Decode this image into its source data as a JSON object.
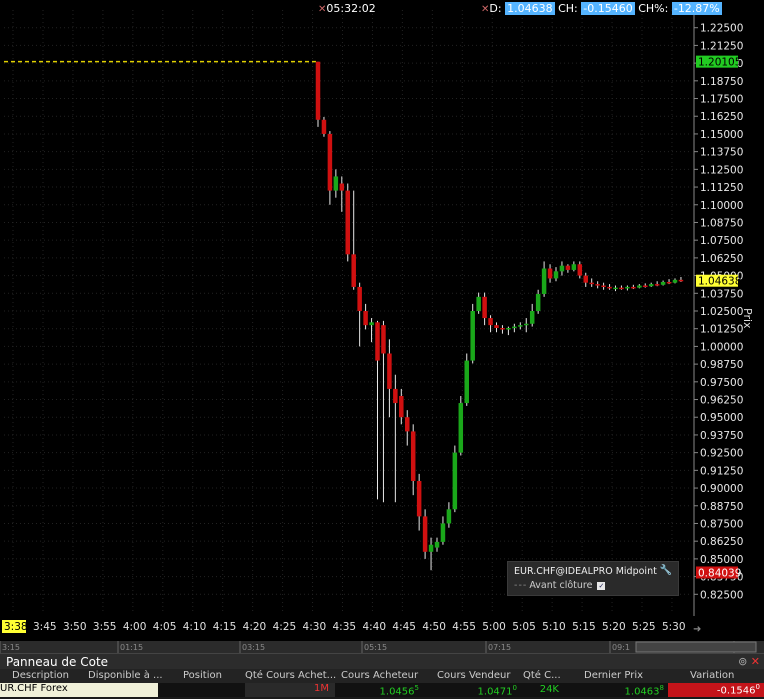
{
  "header": {
    "time": "05:32:02",
    "d_label": "D:",
    "d_value": "1.04638",
    "ch_label": "CH:",
    "ch_value": "-0.15460",
    "chpct_label": "CH%:",
    "chpct_value": "-12.87%"
  },
  "colors": {
    "up": "#1aa81a",
    "down": "#d01010",
    "prior_close": "#e0d000",
    "pill": "#55b4ff",
    "current_price_bg": "#ffff33",
    "prior_close_bg": "#22cc22",
    "low_bg": "#d01010"
  },
  "y_axis": {
    "title": "Prix",
    "min": 0.8125,
    "max": 1.2375,
    "ticks": [
      "1.22500",
      "1.21250",
      "1.20000",
      "1.18750",
      "1.17500",
      "1.16250",
      "1.15000",
      "1.13750",
      "1.12500",
      "1.11250",
      "1.10000",
      "1.08750",
      "1.07500",
      "1.06250",
      "1.05000",
      "1.03750",
      "1.02500",
      "1.01250",
      "1.00000",
      "0.98750",
      "0.97500",
      "0.96250",
      "0.95000",
      "0.93750",
      "0.92500",
      "0.91250",
      "0.90000",
      "0.88750",
      "0.87500",
      "0.86250",
      "0.85000",
      "0.83750",
      "0.82500"
    ],
    "markers": [
      {
        "label": "1.20105",
        "value": 1.20105,
        "kind": "prior_close"
      },
      {
        "label": "1.04638",
        "value": 1.04638,
        "kind": "current"
      },
      {
        "label": "0.84039",
        "value": 0.84039,
        "kind": "low"
      }
    ]
  },
  "x_axis": {
    "labels": [
      "3:38",
      "3:45",
      "3:50",
      "3:55",
      "4:00",
      "4:05",
      "4:10",
      "4:15",
      "4:20",
      "4:25",
      "4:30",
      "4:35",
      "4:40",
      "4:45",
      "4:50",
      "4:55",
      "5:00",
      "5:05",
      "5:10",
      "5:15",
      "5:20",
      "5:25",
      "5:30"
    ],
    "highlighted": "3:38"
  },
  "chart_data": {
    "type": "candlestick",
    "instrument": "EUR.CHF@IDEALPRO Midpoint",
    "prior_close": 1.20105,
    "prior_close_label": "Avant clôture",
    "candles": [
      {
        "t": "4:30",
        "o": 1.201,
        "h": 1.201,
        "l": 1.155,
        "c": 1.16
      },
      {
        "t": "4:31",
        "o": 1.16,
        "h": 1.162,
        "l": 1.148,
        "c": 1.15
      },
      {
        "t": "4:32",
        "o": 1.15,
        "h": 1.152,
        "l": 1.1,
        "c": 1.11
      },
      {
        "t": "4:33",
        "o": 1.11,
        "h": 1.125,
        "l": 1.105,
        "c": 1.12
      },
      {
        "t": "4:34",
        "o": 1.115,
        "h": 1.12,
        "l": 1.095,
        "c": 1.11
      },
      {
        "t": "4:35",
        "o": 1.11,
        "h": 1.115,
        "l": 1.06,
        "c": 1.065
      },
      {
        "t": "4:36",
        "o": 1.065,
        "h": 1.11,
        "l": 1.04,
        "c": 1.042
      },
      {
        "t": "4:37",
        "o": 1.042,
        "h": 1.045,
        "l": 1.0,
        "c": 1.025
      },
      {
        "t": "4:38",
        "o": 1.025,
        "h": 1.03,
        "l": 1.012,
        "c": 1.015
      },
      {
        "t": "4:39",
        "o": 1.015,
        "h": 1.02,
        "l": 1.003,
        "c": 1.017
      },
      {
        "t": "4:40",
        "o": 1.017,
        "h": 1.018,
        "l": 0.892,
        "c": 0.99
      },
      {
        "t": "4:41",
        "o": 1.015,
        "h": 1.018,
        "l": 0.89,
        "c": 0.995
      },
      {
        "t": "4:42",
        "o": 0.995,
        "h": 1.005,
        "l": 0.95,
        "c": 0.97
      },
      {
        "t": "4:43",
        "o": 0.97,
        "h": 0.98,
        "l": 0.89,
        "c": 0.96
      },
      {
        "t": "4:44",
        "o": 0.965,
        "h": 0.97,
        "l": 0.945,
        "c": 0.95
      },
      {
        "t": "4:45",
        "o": 0.95,
        "h": 0.955,
        "l": 0.93,
        "c": 0.94
      },
      {
        "t": "4:46",
        "o": 0.94,
        "h": 0.945,
        "l": 0.895,
        "c": 0.905
      },
      {
        "t": "4:47",
        "o": 0.905,
        "h": 0.91,
        "l": 0.87,
        "c": 0.88
      },
      {
        "t": "4:48",
        "o": 0.88,
        "h": 0.885,
        "l": 0.85,
        "c": 0.855
      },
      {
        "t": "4:49",
        "o": 0.855,
        "h": 0.865,
        "l": 0.842,
        "c": 0.86
      },
      {
        "t": "4:50",
        "o": 0.858,
        "h": 0.865,
        "l": 0.855,
        "c": 0.862
      },
      {
        "t": "4:51",
        "o": 0.862,
        "h": 0.88,
        "l": 0.86,
        "c": 0.875
      },
      {
        "t": "4:52",
        "o": 0.875,
        "h": 0.89,
        "l": 0.872,
        "c": 0.885
      },
      {
        "t": "4:53",
        "o": 0.885,
        "h": 0.93,
        "l": 0.883,
        "c": 0.925
      },
      {
        "t": "4:54",
        "o": 0.925,
        "h": 0.965,
        "l": 0.923,
        "c": 0.96
      },
      {
        "t": "4:55",
        "o": 0.96,
        "h": 0.995,
        "l": 0.958,
        "c": 0.99
      },
      {
        "t": "4:56",
        "o": 0.99,
        "h": 1.03,
        "l": 0.988,
        "c": 1.025
      },
      {
        "t": "4:57",
        "o": 1.025,
        "h": 1.038,
        "l": 1.023,
        "c": 1.035
      },
      {
        "t": "4:58",
        "o": 1.035,
        "h": 1.038,
        "l": 1.015,
        "c": 1.02
      },
      {
        "t": "4:59",
        "o": 1.02,
        "h": 1.022,
        "l": 1.01,
        "c": 1.015
      },
      {
        "t": "5:00",
        "o": 1.015,
        "h": 1.017,
        "l": 1.01,
        "c": 1.013
      },
      {
        "t": "5:01",
        "o": 1.013,
        "h": 1.015,
        "l": 1.009,
        "c": 1.012
      },
      {
        "t": "5:02",
        "o": 1.012,
        "h": 1.014,
        "l": 1.008,
        "c": 1.013
      },
      {
        "t": "5:03",
        "o": 1.013,
        "h": 1.016,
        "l": 1.01,
        "c": 1.014
      },
      {
        "t": "5:04",
        "o": 1.014,
        "h": 1.017,
        "l": 1.012,
        "c": 1.015
      },
      {
        "t": "5:05",
        "o": 1.015,
        "h": 1.02,
        "l": 1.01,
        "c": 1.016
      },
      {
        "t": "5:06",
        "o": 1.016,
        "h": 1.03,
        "l": 1.014,
        "c": 1.025
      },
      {
        "t": "5:07",
        "o": 1.025,
        "h": 1.04,
        "l": 1.023,
        "c": 1.037
      },
      {
        "t": "5:08",
        "o": 1.037,
        "h": 1.06,
        "l": 1.035,
        "c": 1.055
      },
      {
        "t": "5:09",
        "o": 1.055,
        "h": 1.058,
        "l": 1.045,
        "c": 1.048
      },
      {
        "t": "5:10",
        "o": 1.048,
        "h": 1.056,
        "l": 1.046,
        "c": 1.053
      },
      {
        "t": "5:11",
        "o": 1.053,
        "h": 1.06,
        "l": 1.05,
        "c": 1.057
      },
      {
        "t": "5:12",
        "o": 1.057,
        "h": 1.058,
        "l": 1.052,
        "c": 1.054
      },
      {
        "t": "5:13",
        "o": 1.054,
        "h": 1.06,
        "l": 1.053,
        "c": 1.058
      },
      {
        "t": "5:14",
        "o": 1.058,
        "h": 1.06,
        "l": 1.048,
        "c": 1.05
      },
      {
        "t": "5:15",
        "o": 1.05,
        "h": 1.052,
        "l": 1.042,
        "c": 1.045
      },
      {
        "t": "5:16",
        "o": 1.045,
        "h": 1.048,
        "l": 1.042,
        "c": 1.044
      },
      {
        "t": "5:17",
        "o": 1.044,
        "h": 1.046,
        "l": 1.041,
        "c": 1.043
      },
      {
        "t": "5:18",
        "o": 1.043,
        "h": 1.045,
        "l": 1.04,
        "c": 1.042
      },
      {
        "t": "5:19",
        "o": 1.042,
        "h": 1.044,
        "l": 1.04,
        "c": 1.041
      },
      {
        "t": "5:20",
        "o": 1.041,
        "h": 1.043,
        "l": 1.039,
        "c": 1.0415
      },
      {
        "t": "5:21",
        "o": 1.0415,
        "h": 1.043,
        "l": 1.04,
        "c": 1.041
      },
      {
        "t": "5:22",
        "o": 1.041,
        "h": 1.043,
        "l": 1.0395,
        "c": 1.042
      },
      {
        "t": "5:23",
        "o": 1.042,
        "h": 1.0435,
        "l": 1.0405,
        "c": 1.0415
      },
      {
        "t": "5:24",
        "o": 1.0415,
        "h": 1.044,
        "l": 1.041,
        "c": 1.043
      },
      {
        "t": "5:25",
        "o": 1.043,
        "h": 1.0445,
        "l": 1.0415,
        "c": 1.0425
      },
      {
        "t": "5:26",
        "o": 1.0425,
        "h": 1.045,
        "l": 1.042,
        "c": 1.044
      },
      {
        "t": "5:27",
        "o": 1.044,
        "h": 1.046,
        "l": 1.0425,
        "c": 1.0435
      },
      {
        "t": "5:28",
        "o": 1.0435,
        "h": 1.0465,
        "l": 1.043,
        "c": 1.0455
      },
      {
        "t": "5:29",
        "o": 1.0455,
        "h": 1.0475,
        "l": 1.044,
        "c": 1.045
      },
      {
        "t": "5:30",
        "o": 1.045,
        "h": 1.048,
        "l": 1.0445,
        "c": 1.047
      },
      {
        "t": "5:31",
        "o": 1.047,
        "h": 1.049,
        "l": 1.0455,
        "c": 1.0464
      }
    ]
  },
  "timeline": {
    "labels": [
      "3:15",
      "01:15",
      "03:15",
      "05:15",
      "07:15",
      "09:1",
      "11:1"
    ]
  },
  "panel": {
    "title": "Panneau de Cote",
    "columns": [
      "Description",
      "Disponible à ...",
      "Position",
      "Qté Cours Achet...",
      "Cours Acheteur",
      "Cours Vendeur",
      "Qté C...",
      "Dernier Prix",
      "Variation"
    ],
    "row": {
      "description": "UR.CHF Forex",
      "disponible": "",
      "position": "",
      "qte_achat": "1M",
      "bid": "1.0456",
      "bid_sup": "5",
      "ask": "1.0471",
      "ask_sup": "0",
      "qte_vente": "24K",
      "last": "1.0463",
      "last_sup": "8",
      "variation": "-0.1546",
      "variation_sup": "0"
    }
  }
}
